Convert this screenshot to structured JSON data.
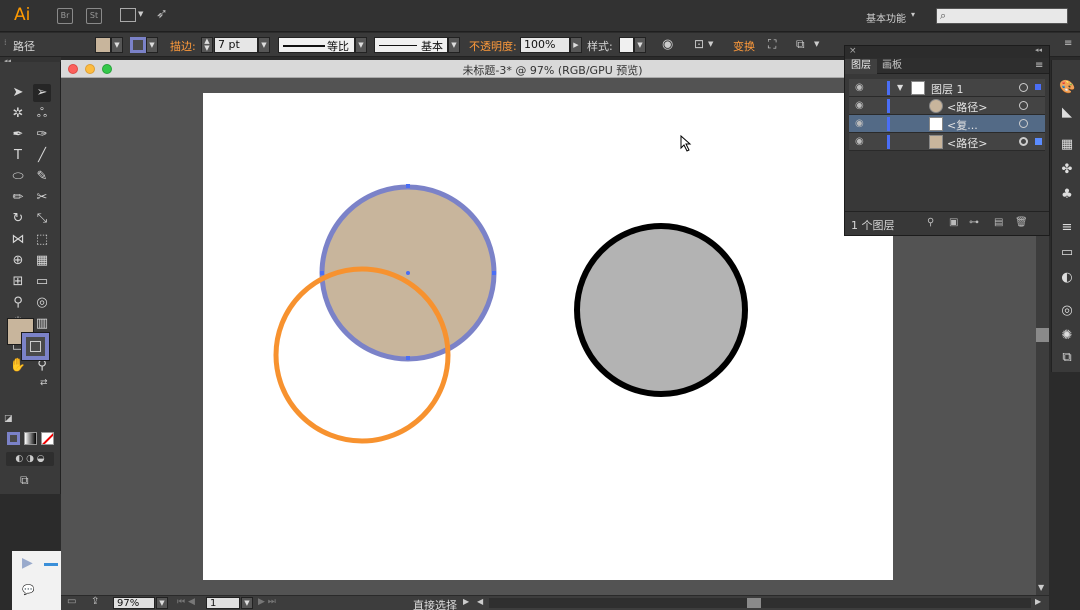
{
  "app": {
    "logo": "Ai",
    "bridge_label": "Br",
    "stock_label": "St",
    "workspace": "基本功能",
    "search_placeholder": ""
  },
  "control_bar": {
    "object_type": "路径",
    "stroke_label": "描边:",
    "stroke_weight": "7 pt",
    "profile_label": "等比",
    "brush_label": "基本",
    "opacity_label": "不透明度:",
    "opacity_value": "100%",
    "style_label": "样式:",
    "transform_label": "变换"
  },
  "document": {
    "title": "未标题-3* @ 97% (RGB/GPU 预览)",
    "zoom": "97%",
    "artboard_index": "1",
    "status_mode": "直接选择"
  },
  "layers_panel": {
    "tabs": [
      "图层",
      "画板"
    ],
    "rows": [
      {
        "name": "图层 1"
      },
      {
        "name": "<路径>"
      },
      {
        "name": "<复..."
      },
      {
        "name": "<路径>"
      }
    ],
    "count_label": "1 个图层"
  },
  "colors": {
    "accent_orange": "#ff9a3a",
    "fill_tan": "#c8b59c",
    "stroke_blue": "#7b82c8",
    "circle_orange": "#f7922f",
    "circle_gray": "#b3b3b3",
    "selection_blue": "#4a6ef5"
  }
}
